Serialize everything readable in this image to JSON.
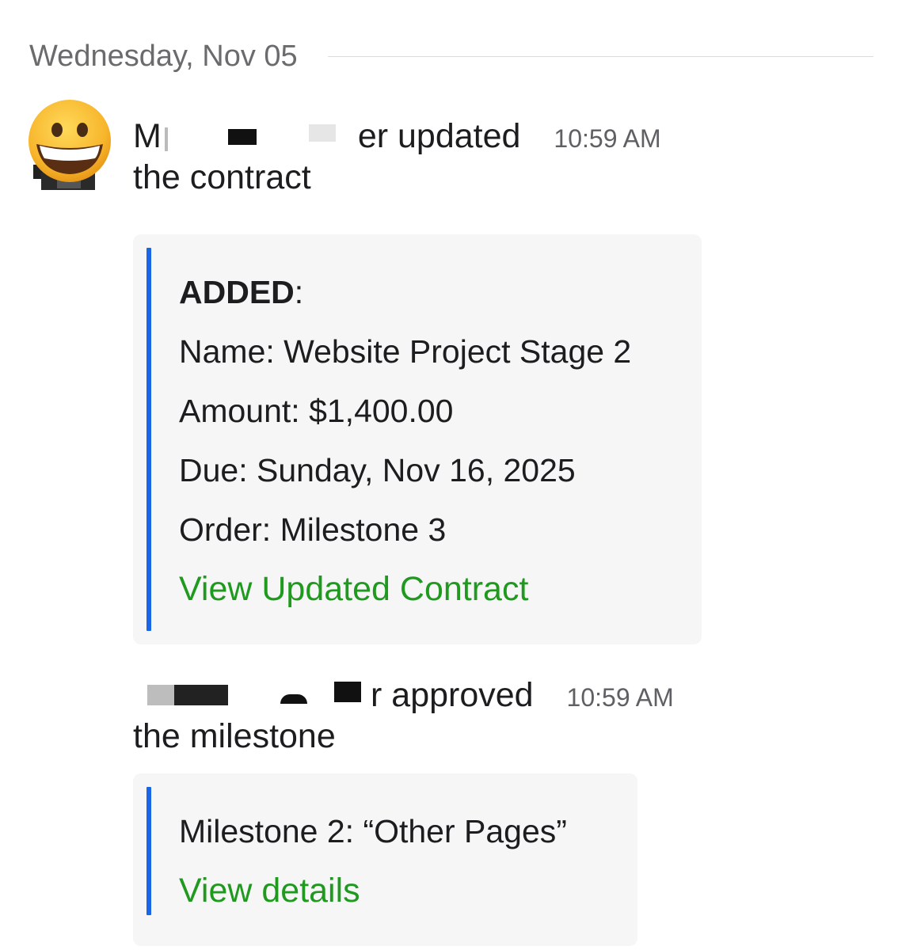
{
  "date_divider": "Wednesday, Nov 05",
  "messages": [
    {
      "author_visible_start": "M",
      "author_visible_end": "er",
      "action": "updated",
      "object": "the contract",
      "time": "10:59 AM",
      "card": {
        "heading": "ADDED",
        "heading_suffix": ":",
        "lines": [
          "Name: Website Project Stage 2",
          "Amount: $1,400.00",
          "Due: Sunday, Nov 16, 2025",
          "Order: Milestone 3"
        ],
        "link": "View Updated Contract"
      }
    },
    {
      "author_visible_end": "r",
      "action": "approved",
      "object": "the milestone",
      "time": "10:59 AM",
      "card": {
        "lines": [
          "Milestone 2: “Other Pages”"
        ],
        "link": "View details"
      }
    }
  ],
  "colors": {
    "accent_bar": "#1a66e8",
    "link": "#1f9a1f",
    "card_bg": "#f6f6f7",
    "muted_text": "#6b6b6e"
  },
  "icons": {
    "avatar": "grinning-face-emoji"
  }
}
